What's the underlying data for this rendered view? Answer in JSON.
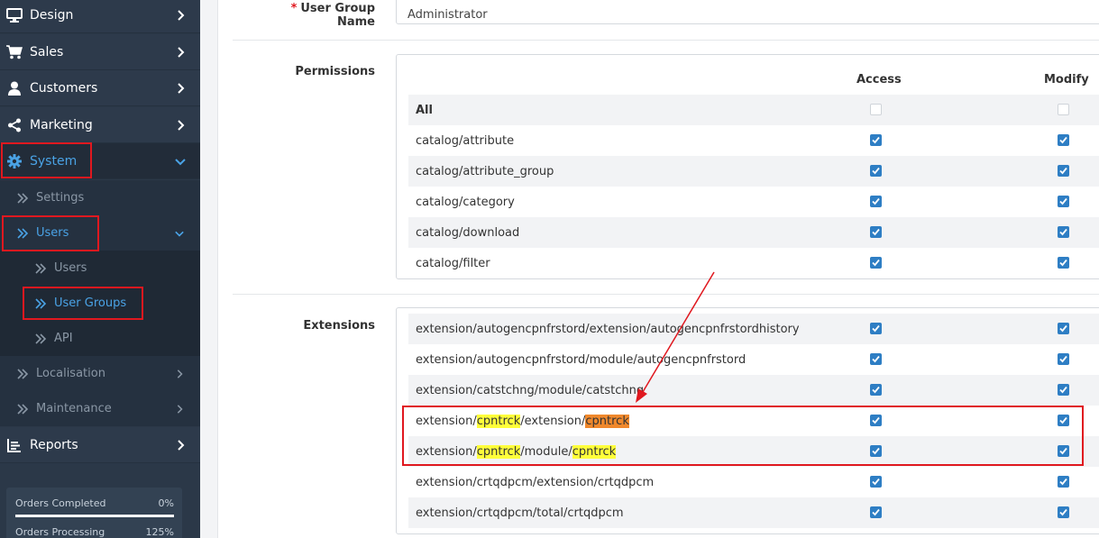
{
  "sidebar": {
    "design": "Design",
    "sales": "Sales",
    "customers": "Customers",
    "marketing": "Marketing",
    "system": "System",
    "settings": "Settings",
    "users_group": "Users",
    "users": "Users",
    "user_groups": "User Groups",
    "api": "API",
    "localisation": "Localisation",
    "maintenance": "Maintenance",
    "reports": "Reports",
    "stats": [
      {
        "label": "Orders Completed",
        "value": "0%"
      },
      {
        "label": "Orders Processing",
        "value": "125%"
      }
    ]
  },
  "form": {
    "name_label": "User Group Name",
    "required_mark": "*",
    "name_value": "Administrator",
    "permissions_label": "Permissions",
    "extensions_label": "Extensions",
    "access_header": "Access",
    "modify_header": "Modify",
    "all_label": "All",
    "permissions": [
      "catalog/attribute",
      "catalog/attribute_group",
      "catalog/category",
      "catalog/download",
      "catalog/filter"
    ],
    "extensions": [
      "extension/autogencpnfrstord/extension/autogencpnfrstordhistory",
      "extension/autogencpnfrstord/module/autogencpnfrstord",
      "extension/catstchng/module/catstchng"
    ],
    "ext_cp1": {
      "a": "extension/",
      "b": "cpntrck",
      "c": "/extension/",
      "d": "cpntrck"
    },
    "ext_cp2": {
      "a": "extension/",
      "b": "cpntrck",
      "c": "/module/",
      "d": "cpntrck"
    },
    "extensions_tail": [
      "extension/crtqdpcm/extension/crtqdpcm",
      "extension/crtqdpcm/total/crtqdpcm"
    ]
  },
  "colors": {
    "sidebar": "#2b3848",
    "accent": "#4aa3e6",
    "highlight_box": "#e0181f",
    "mark_yellow": "#ffff3a",
    "mark_orange": "#f0882c"
  }
}
